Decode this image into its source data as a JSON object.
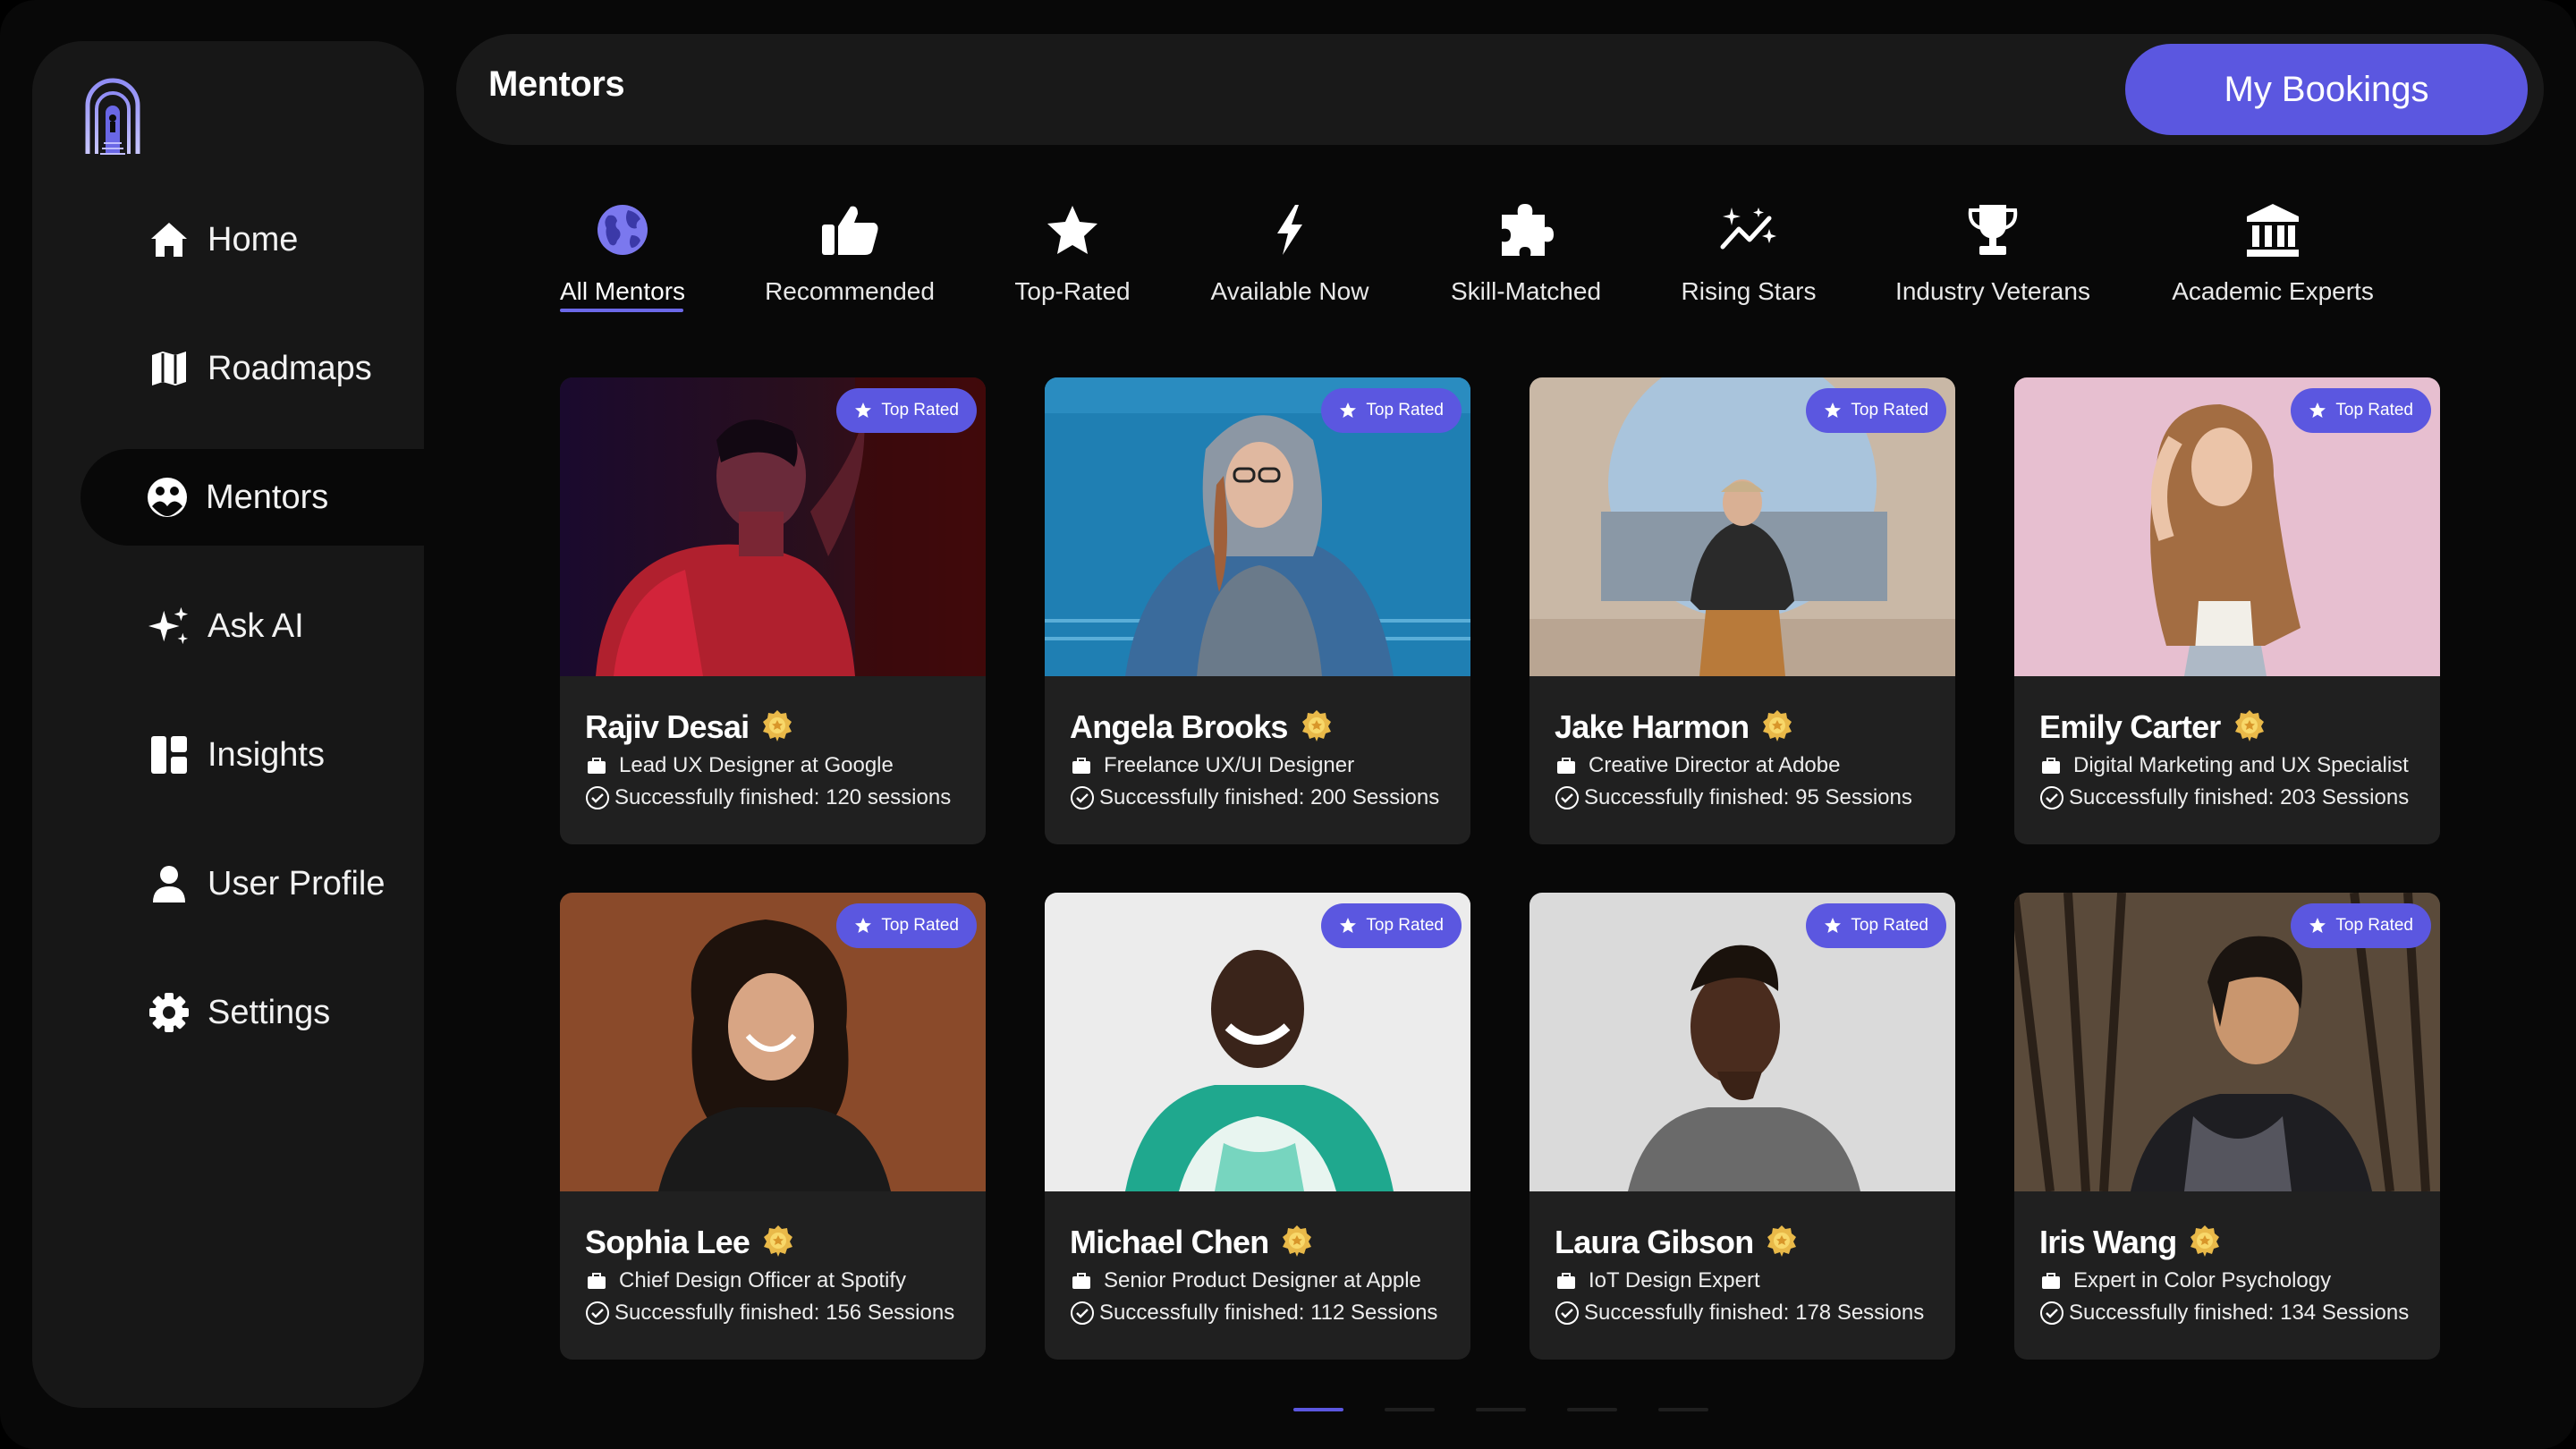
{
  "app": {
    "accent": "#5b57e0"
  },
  "sidebar": {
    "logo_icon": "arch-door-logo",
    "items": [
      {
        "label": "Home",
        "icon": "home-icon",
        "active": false
      },
      {
        "label": "Roadmaps",
        "icon": "map-icon",
        "active": false
      },
      {
        "label": "Mentors",
        "icon": "mentors-icon",
        "active": true
      },
      {
        "label": "Ask AI",
        "icon": "sparkles-icon",
        "active": false
      },
      {
        "label": "Insights",
        "icon": "dashboard-icon",
        "active": false
      },
      {
        "label": "User Profile",
        "icon": "user-icon",
        "active": false
      },
      {
        "label": "Settings",
        "icon": "gear-icon",
        "active": false
      }
    ]
  },
  "header": {
    "title": "Mentors",
    "bookings_label": "My Bookings"
  },
  "categories": [
    {
      "label": "All Mentors",
      "icon": "globe-icon",
      "active": true
    },
    {
      "label": "Recommended",
      "icon": "thumbs-up-icon",
      "active": false
    },
    {
      "label": "Top-Rated",
      "icon": "star-icon",
      "active": false
    },
    {
      "label": "Available Now",
      "icon": "bolt-icon",
      "active": false
    },
    {
      "label": "Skill-Matched",
      "icon": "puzzle-icon",
      "active": false
    },
    {
      "label": "Rising Stars",
      "icon": "trend-sparkle-icon",
      "active": false
    },
    {
      "label": "Industry Veterans",
      "icon": "trophy-icon",
      "active": false
    },
    {
      "label": "Academic Experts",
      "icon": "institution-icon",
      "active": false
    }
  ],
  "mentors": [
    {
      "badge": "Top Rated",
      "name": "Rajiv Desai",
      "role": "Lead UX Designer at Google",
      "sessions": "Successfully finished: 120 sessions"
    },
    {
      "badge": "Top Rated",
      "name": "Angela Brooks",
      "role": "Freelance UX/UI Designer",
      "sessions": "Successfully finished: 200 Sessions"
    },
    {
      "badge": "Top Rated",
      "name": "Jake Harmon",
      "role": "Creative Director at Adobe",
      "sessions": "Successfully finished: 95 Sessions"
    },
    {
      "badge": "Top Rated",
      "name": "Emily Carter",
      "role": "Digital Marketing and UX Specialist",
      "sessions": "Successfully finished: 203 Sessions"
    },
    {
      "badge": "Top Rated",
      "name": "Sophia Lee",
      "role": "Chief Design Officer at Spotify",
      "sessions": "Successfully finished: 156 Sessions"
    },
    {
      "badge": "Top Rated",
      "name": "Michael Chen",
      "role": "Senior Product Designer at Apple",
      "sessions": "Successfully finished: 112 Sessions"
    },
    {
      "badge": "Top Rated",
      "name": "Laura Gibson",
      "role": "IoT Design Expert",
      "sessions": "Successfully finished: 178 Sessions"
    },
    {
      "badge": "Top Rated",
      "name": "Iris Wang",
      "role": "Expert in Color Psychology",
      "sessions": "Successfully finished: 134 Sessions"
    }
  ],
  "pagination": {
    "pages": 5,
    "current": 1
  }
}
